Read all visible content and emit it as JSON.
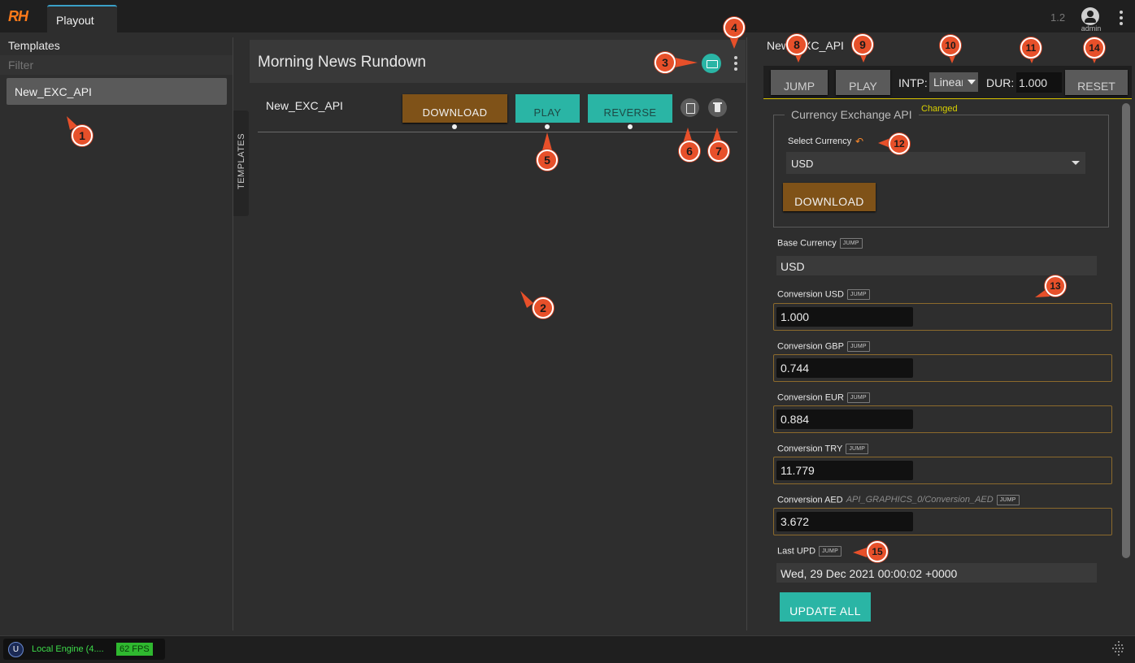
{
  "app": {
    "logo_text": "RH",
    "tab_label": "Playout",
    "version": "1.2",
    "user_label": "admin"
  },
  "templates_panel": {
    "title": "Templates",
    "filter_placeholder": "Filter",
    "items": [
      {
        "label": "New_EXC_API"
      }
    ],
    "side_tab_label": "TEMPLATES"
  },
  "rundown": {
    "title": "Morning News Rundown",
    "rows": [
      {
        "name": "New_EXC_API",
        "buttons": [
          {
            "label": "DOWNLOAD",
            "color": "#7f5218"
          },
          {
            "label": "PLAY",
            "color": "#2ab5a5"
          },
          {
            "label": "REVERSE",
            "color": "#2ab5a5"
          }
        ]
      }
    ]
  },
  "detail_panel": {
    "title": "New_EXC_API",
    "toolbar": {
      "jump_label": "JUMP",
      "play_label": "PLAY",
      "intp_label": "INTP:",
      "intp_value": "Linear",
      "dur_label": "DUR:",
      "dur_value": "1.000",
      "reset_label": "RESET"
    },
    "changed_label": "Changed",
    "group": {
      "legend": "Currency Exchange API",
      "select_label": "Select Currency",
      "select_value": "USD",
      "download_label": "DOWNLOAD"
    },
    "jump_badge": "JUMP",
    "fields": [
      {
        "label": "Base Currency",
        "value": "USD",
        "readonly": true
      },
      {
        "label": "Conversion USD",
        "value": "1.000"
      },
      {
        "label": "Conversion GBP",
        "value": "0.744"
      },
      {
        "label": "Conversion EUR",
        "value": "0.884"
      },
      {
        "label": "Conversion TRY",
        "value": "11.779"
      },
      {
        "label": "Conversion AED",
        "path": "API_GRAPHICS_0/Conversion_AED",
        "value": "3.672"
      },
      {
        "label": "Last UPD",
        "value": "Wed, 29 Dec 2021 00:00:02 +0000",
        "readonly": true
      }
    ],
    "update_all_label": "UPDATE ALL"
  },
  "status_bar": {
    "engine_label": "Local Engine (4....",
    "fps": "62 FPS"
  },
  "markers": [
    "1",
    "2",
    "3",
    "4",
    "5",
    "6",
    "7",
    "8",
    "9",
    "10",
    "11",
    "12",
    "13",
    "14",
    "15"
  ],
  "colors": {
    "accent_teal": "#2ab5a5",
    "accent_brown": "#7f5218",
    "marker_orange": "#e7502a",
    "changed_yellow": "#d9d100"
  }
}
